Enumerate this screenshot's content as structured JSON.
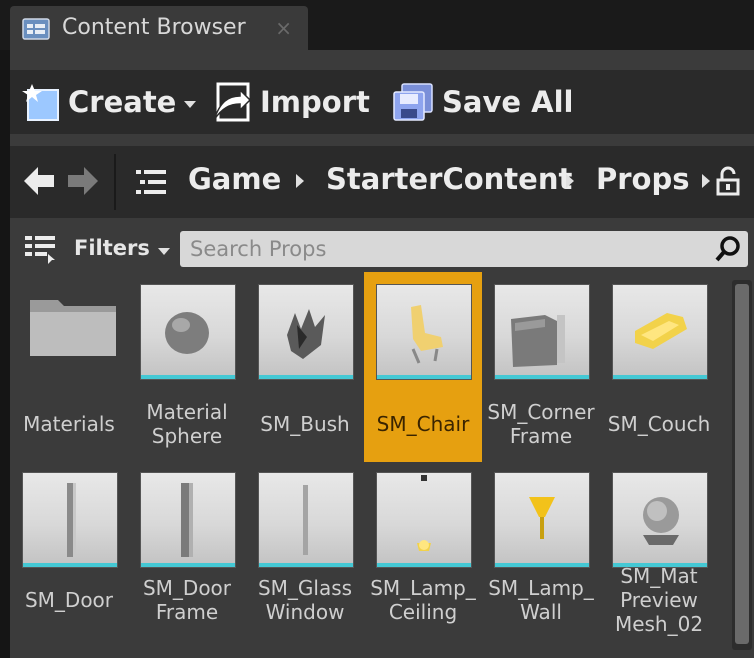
{
  "tab": {
    "title": "Content Browser",
    "close": "×",
    "icon": "content-browser-icon"
  },
  "toolbar": {
    "create_label": "Create",
    "import_label": "Import",
    "save_all_label": "Save All"
  },
  "path": {
    "crumbs": [
      "Game",
      "StarterContent",
      "Props"
    ]
  },
  "filters": {
    "label": "Filters"
  },
  "search": {
    "placeholder": "Search Props"
  },
  "assets": [
    {
      "name": "Materials",
      "kind": "folder"
    },
    {
      "name": "Material Sphere",
      "kind": "asset"
    },
    {
      "name": "SM_Bush",
      "kind": "asset"
    },
    {
      "name": "SM_Chair",
      "kind": "asset",
      "selected": true
    },
    {
      "name": "SM_Corner Frame",
      "kind": "asset"
    },
    {
      "name": "SM_Couch",
      "kind": "asset"
    },
    {
      "name": "SM_Door",
      "kind": "asset"
    },
    {
      "name": "SM_Door Frame",
      "kind": "asset"
    },
    {
      "name": "SM_Glass Window",
      "kind": "asset"
    },
    {
      "name": "SM_Lamp_ Ceiling",
      "kind": "asset"
    },
    {
      "name": "SM_Lamp_ Wall",
      "kind": "asset"
    },
    {
      "name": "SM_Mat Preview Mesh_02",
      "kind": "asset"
    }
  ],
  "colors": {
    "selection": "#e6a010",
    "thumb_accent": "#44c8d4",
    "panel": "#3b3b3b"
  }
}
